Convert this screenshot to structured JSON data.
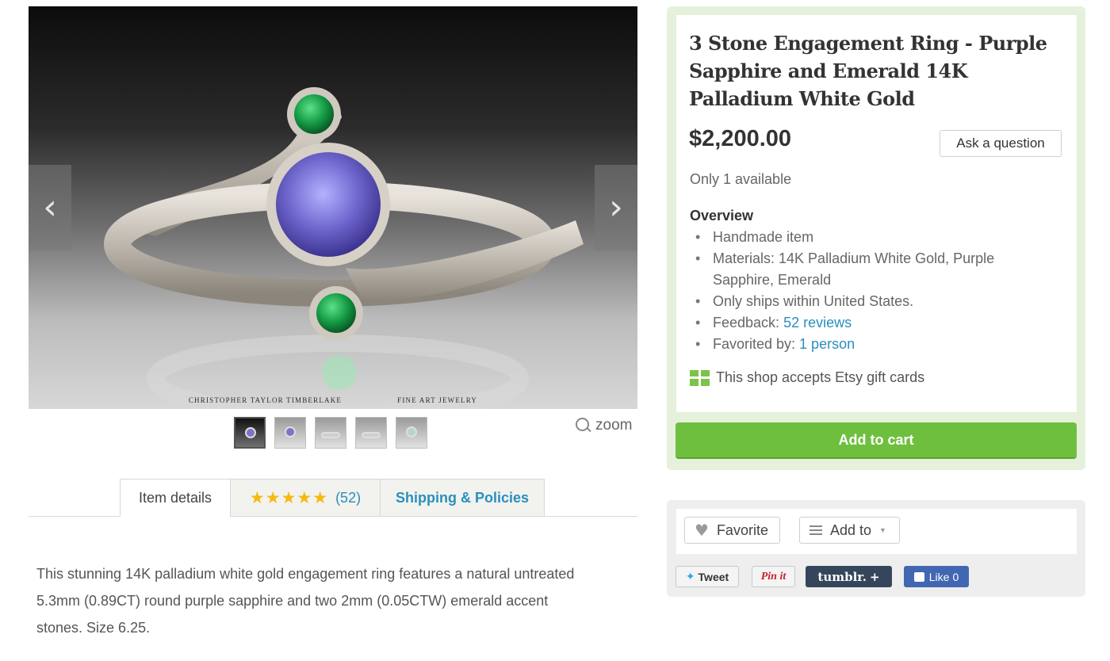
{
  "gallery": {
    "watermark_left": "CHRISTOPHER TAYLOR TIMBERLAKE",
    "watermark_right": "FINE ART JEWELRY",
    "prev_arrow": "‹",
    "next_arrow": "›",
    "thumbnail_count": 5,
    "active_thumbnail": 1,
    "zoom_label": "zoom"
  },
  "tabs": {
    "details_label": "Item details",
    "reviews_rating": 5,
    "reviews_count": "(52)",
    "shipping_label": "Shipping & Policies"
  },
  "description": "This stunning 14K palladium white gold engagement ring features a natural untreated 5.3mm (0.89CT) round purple sapphire and two 2mm (0.05CTW) emerald accent stones. Size 6.25.",
  "listing": {
    "title": "3 Stone Engagement Ring - Purple Sapphire and Emerald 14K Palladium White Gold",
    "price": "$2,200.00",
    "ask_label": "Ask a question",
    "availability": "Only 1 available",
    "overview_heading": "Overview",
    "overview": {
      "item1": "Handmade item",
      "item2": "Materials: 14K Palladium White Gold, Purple Sapphire, Emerald",
      "item3": "Only ships within United States.",
      "feedback_prefix": "Feedback: ",
      "feedback_link": "52 reviews",
      "favorited_prefix": "Favorited by: ",
      "favorited_link": "1 person"
    },
    "gift_text": "This shop accepts Etsy gift cards",
    "cart_label": "Add to cart"
  },
  "actions": {
    "favorite_label": "Favorite",
    "addto_label": "Add to",
    "tweet_label": "Tweet",
    "pin_label": "Pin it",
    "tumblr_label": "tumblr.",
    "tumblr_plus": "+",
    "like_label": "Like",
    "like_count": "0"
  },
  "colors": {
    "accent_link": "#2a8fbd",
    "cart_green": "#6fbf3f",
    "star_gold": "#f5b90f",
    "buy_card_bg": "#e6f1dc"
  },
  "icons": [
    "chevron-left-icon",
    "chevron-right-icon",
    "magnifier-icon",
    "star-icon",
    "gift-card-icon",
    "heart-icon",
    "list-icon",
    "caret-down-icon",
    "twitter-bird-icon",
    "facebook-thumb-icon"
  ]
}
